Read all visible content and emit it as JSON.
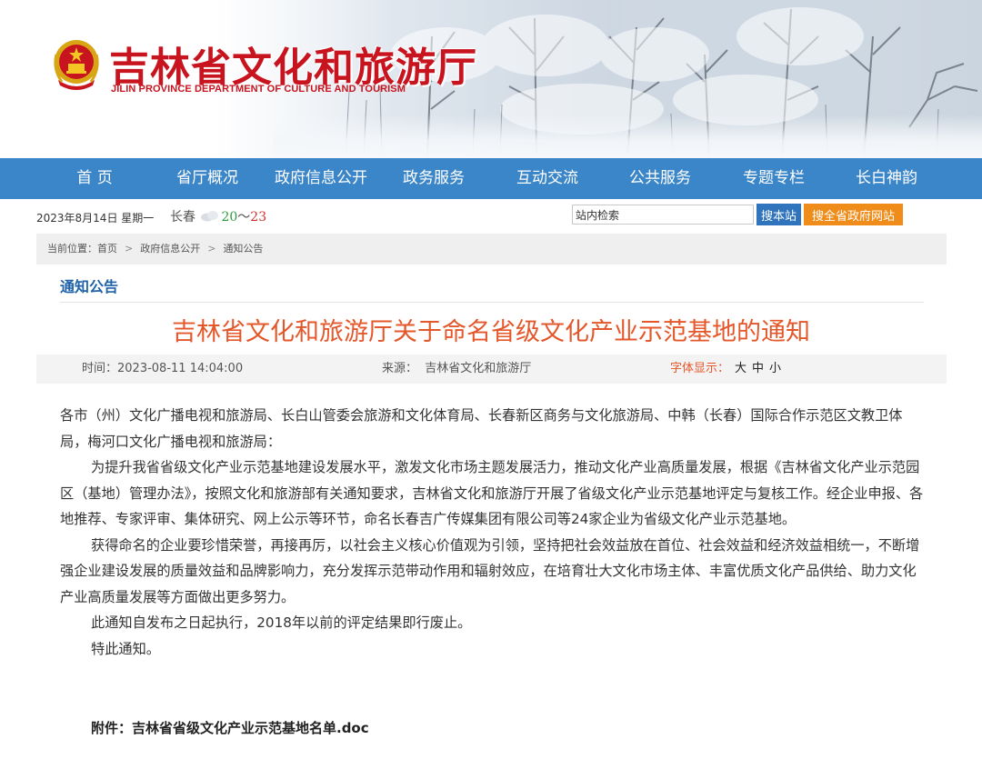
{
  "header": {
    "site_title": "吉林省文化和旅游厅",
    "site_subtitle": "JILIN PROVINCE DEPARTMENT OF CULTURE AND TOURISM",
    "emblem_icon": "national-emblem-icon",
    "colors": {
      "title_red": "#c8141e",
      "nav_blue": "#3b86c8"
    }
  },
  "nav": {
    "items": [
      "首 页",
      "省厅概况",
      "政府信息公开",
      "政务服务",
      "互动交流",
      "公共服务",
      "专题专栏",
      "长白神韵"
    ]
  },
  "infobar": {
    "date": "2023年8月14日 星期一",
    "weather": {
      "city": "长春",
      "icon": "cloud-icon",
      "low": "20",
      "sep": "～",
      "high": "23"
    },
    "search_placeholder": "站内检索",
    "search_button": "搜本站",
    "search_gov_button": "搜全省政府网站"
  },
  "breadcrumb": {
    "prefix": "当前位置：",
    "items": [
      "首页",
      "政府信息公开",
      "通知公告"
    ],
    "separator": ">"
  },
  "section": {
    "title": "通知公告"
  },
  "article": {
    "title": "吉林省文化和旅游厅关于命名省级文化产业示范基地的通知",
    "time_label": "时间：",
    "time": "2023-08-11 14:04:00",
    "source_label": "来源：",
    "source": "吉林省文化和旅游厅",
    "font_size_label": "字体显示：",
    "font_sizes": [
      "大",
      "中",
      "小"
    ],
    "paragraphs": [
      "各市（州）文化广播电视和旅游局、长白山管委会旅游和文化体育局、长春新区商务与文化旅游局、中韩（长春）国际合作示范区文教卫体局，梅河口文化广播电视和旅游局：",
      "为提升我省省级文化产业示范基地建设发展水平，激发文化市场主题发展活力，推动文化产业高质量发展，根据《吉林省文化产业示范园区（基地）管理办法》，按照文化和旅游部有关通知要求，吉林省文化和旅游厅开展了省级文化产业示范基地评定与复核工作。经企业申报、各地推荐、专家评审、集体研究、网上公示等环节，命名长春吉广传媒集团有限公司等24家企业为省级文化产业示范基地。",
      "获得命名的企业要珍惜荣誉，再接再厉，以社会主义核心价值观为引领，坚持把社会效益放在首位、社会效益和经济效益相统一，不断增强企业建设发展的质量效益和品牌影响力，充分发挥示范带动作用和辐射效应，在培育壮大文化市场主体、丰富优质文化产品供给、助力文化产业高质量发展等方面做出更多努力。",
      "此通知自发布之日起执行，2018年以前的评定结果即行废止。",
      "特此通知。"
    ],
    "attachment": "附件：吉林省省级文化产业示范基地名单.doc"
  }
}
